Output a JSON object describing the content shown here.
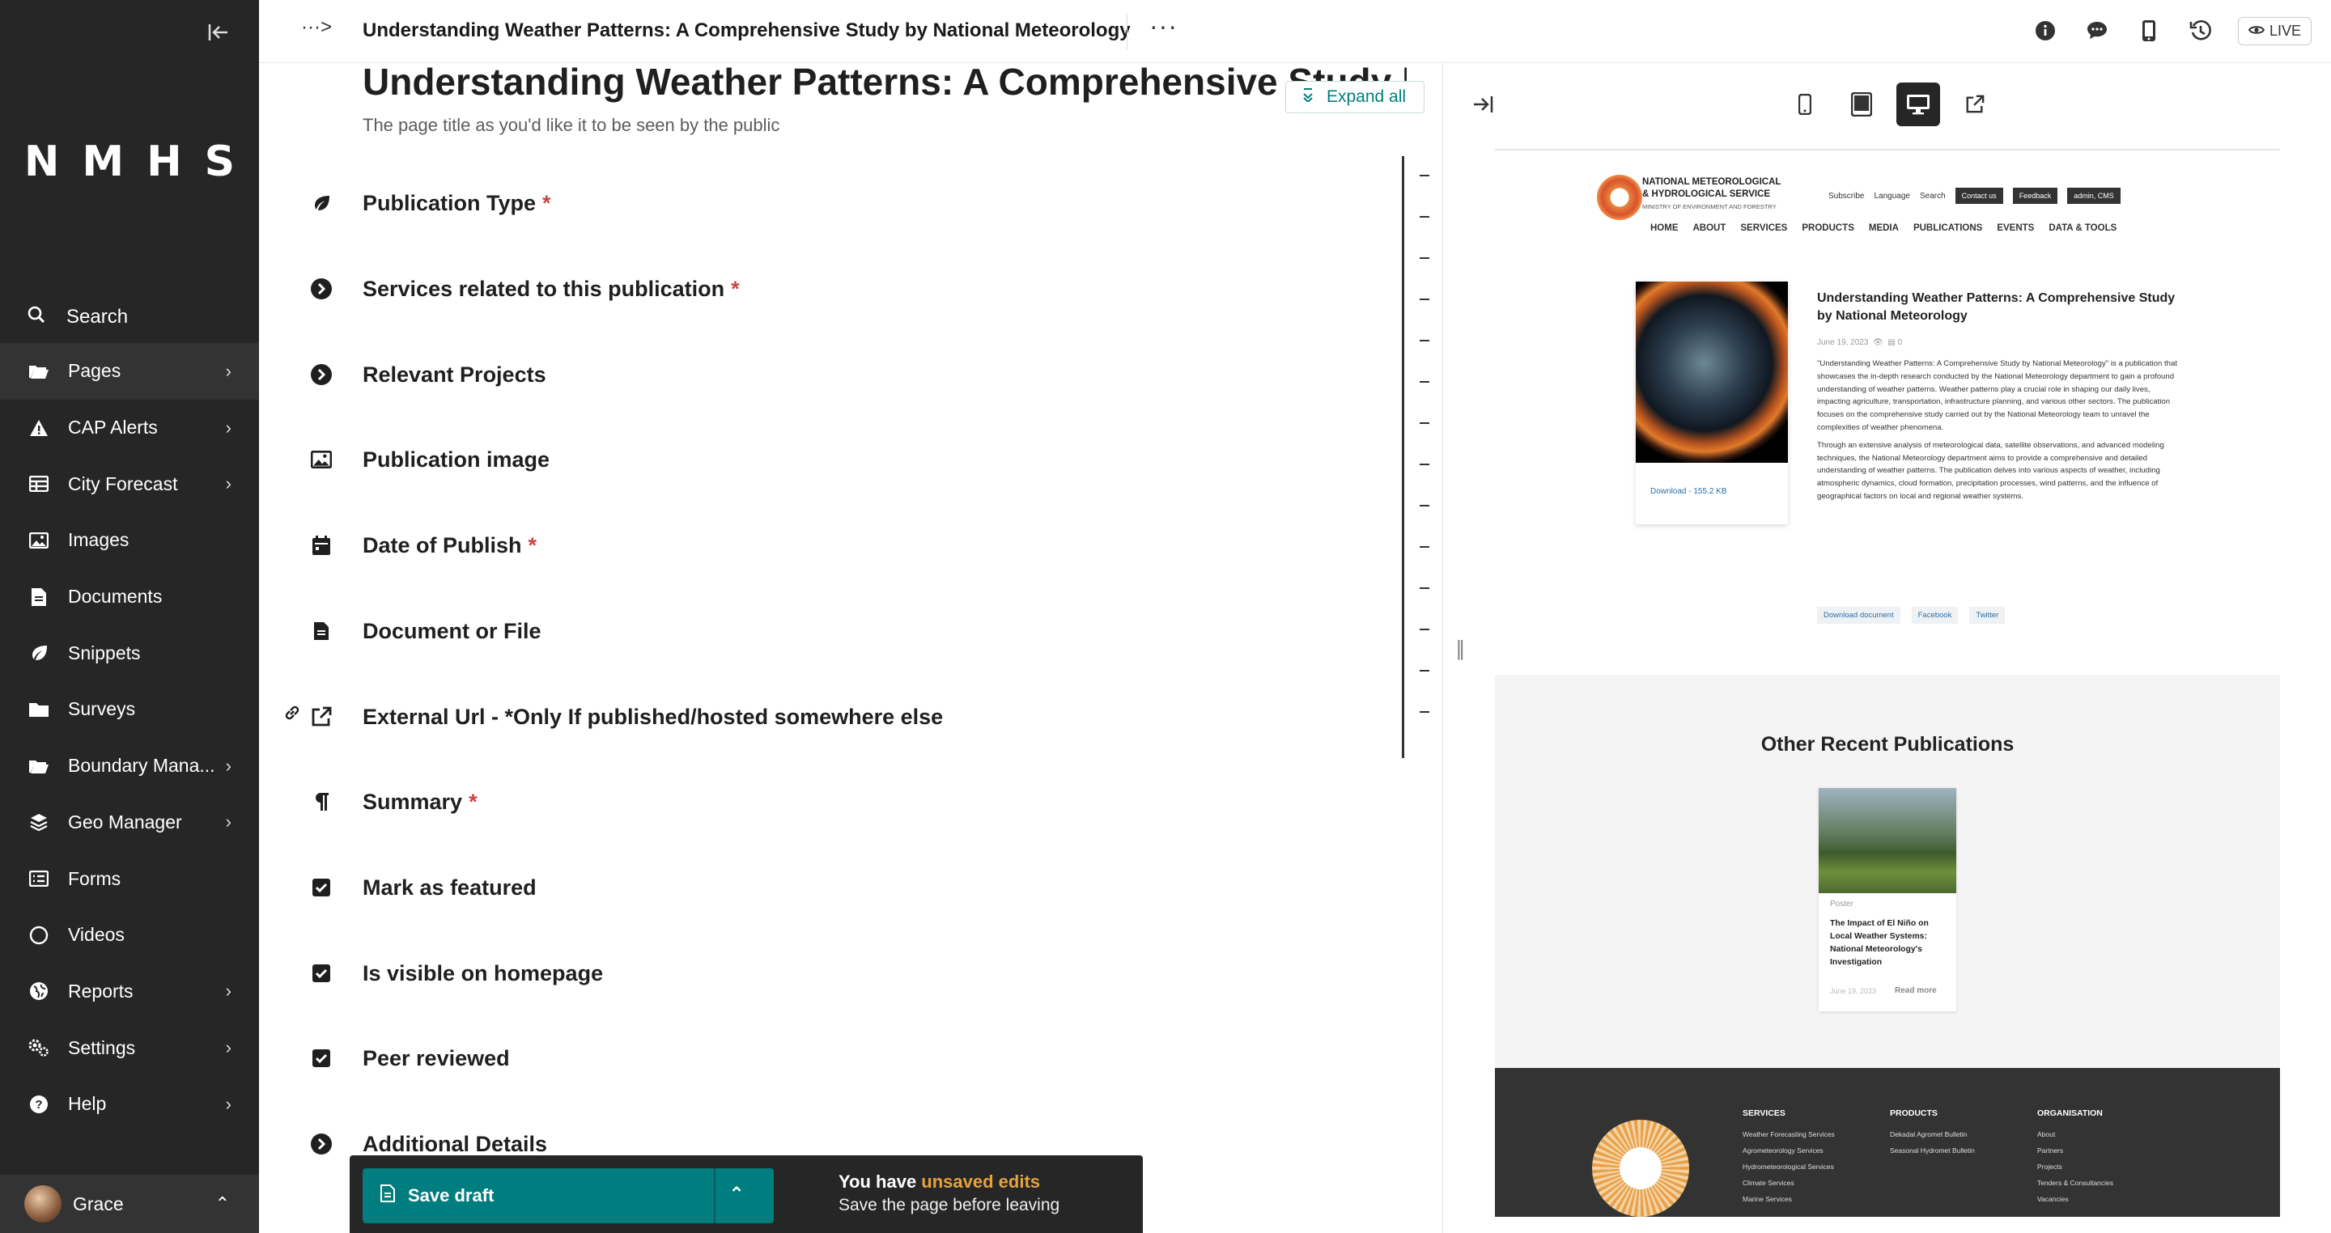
{
  "sidebar": {
    "logo": "NMHS",
    "search_label": "Search",
    "items": [
      {
        "label": "Pages",
        "chevron": true
      },
      {
        "label": "CAP Alerts",
        "chevron": true
      },
      {
        "label": "City Forecast",
        "chevron": true
      },
      {
        "label": "Images",
        "chevron": false
      },
      {
        "label": "Documents",
        "chevron": false
      },
      {
        "label": "Snippets",
        "chevron": false
      },
      {
        "label": "Surveys",
        "chevron": false
      },
      {
        "label": "Boundary Mana...",
        "chevron": true
      },
      {
        "label": "Geo Manager",
        "chevron": true
      },
      {
        "label": "Forms",
        "chevron": false
      },
      {
        "label": "Videos",
        "chevron": false
      },
      {
        "label": "Reports",
        "chevron": true
      },
      {
        "label": "Settings",
        "chevron": true
      },
      {
        "label": "Help",
        "chevron": true
      }
    ],
    "account_name": "Grace"
  },
  "header": {
    "title": "Understanding Weather Patterns: A Comprehensive Study by National Meteorology",
    "live_label": "LIVE"
  },
  "editor": {
    "title_value": "Understanding Weather Patterns: A Comprehensive Study by National Meteorology",
    "title_help": "The page title as you'd like it to be seen by the public",
    "expand_all": "Expand all",
    "fields": [
      {
        "label": "Publication Type",
        "required": true,
        "icon": "leaf-icon"
      },
      {
        "label": "Services related to this publication",
        "required": true,
        "icon": "chevron-circle-icon"
      },
      {
        "label": "Relevant Projects",
        "required": false,
        "icon": "chevron-circle-icon"
      },
      {
        "label": "Publication image",
        "required": false,
        "icon": "image-icon"
      },
      {
        "label": "Date of Publish",
        "required": true,
        "icon": "calendar-icon"
      },
      {
        "label": "Document or File",
        "required": false,
        "icon": "document-icon"
      },
      {
        "label": "External Url - *Only If published/hosted somewhere else",
        "required": false,
        "icon": "external-link-icon"
      },
      {
        "label": "Summary",
        "required": true,
        "icon": "pilcrow-icon"
      },
      {
        "label": "Mark as featured",
        "required": false,
        "icon": "checkbox-icon"
      },
      {
        "label": "Is visible on homepage",
        "required": false,
        "icon": "checkbox-icon"
      },
      {
        "label": "Peer reviewed",
        "required": false,
        "icon": "checkbox-icon"
      },
      {
        "label": "Additional Details",
        "required": false,
        "icon": "chevron-circle-icon"
      }
    ],
    "required_mark": "*"
  },
  "footer": {
    "save_label": "Save draft",
    "unsaved_prefix": "You have ",
    "unsaved_highlight": "unsaved edits",
    "unsaved_sub": "Save the page before leaving"
  },
  "preview": {
    "org_line1": "NATIONAL METEOROLOGICAL",
    "org_line2": "& HYDROLOGICAL SERVICE",
    "org_line3": "MINISTRY OF ENVIRONMENT AND FORESTRY",
    "util": {
      "subscribe": "Subscribe",
      "language": "Language",
      "search": "Search",
      "contact": "Contact us",
      "feedback": "Feedback",
      "admin": "admin, CMS"
    },
    "nav": [
      "HOME",
      "ABOUT",
      "SERVICES",
      "PRODUCTS",
      "MEDIA",
      "PUBLICATIONS",
      "EVENTS",
      "DATA & TOOLS"
    ],
    "pub_title": "Understanding Weather Patterns: A Comprehensive Study by National Meteorology",
    "pub_date": "June 19, 2023",
    "pub_count": "0",
    "download_label": "Download - 155.2 KB",
    "body_p1": "\"Understanding Weather Patterns: A Comprehensive Study by National Meteorology\" is a publication that showcases the in-depth research conducted by the National Meteorology department to gain a profound understanding of weather patterns. Weather patterns play a crucial role in shaping our daily lives, impacting agriculture, transportation, infrastructure planning, and various other sectors. The publication focuses on the comprehensive study carried out by the National Meteorology team to unravel the complexities of weather phenomena.",
    "body_p2": "Through an extensive analysis of meteorological data, satellite observations, and advanced modeling techniques, the National Meteorology department aims to provide a comprehensive and detailed understanding of weather patterns. The publication delves into various aspects of weather, including atmospheric dynamics, cloud formation, precipitation processes, wind patterns, and the influence of geographical factors on local and regional weather systems.",
    "actions": [
      "Download document",
      "Facebook",
      "Twitter"
    ],
    "other_title": "Other Recent Publications",
    "other_card": {
      "category": "Poster",
      "title": "The Impact of El Niño on Local Weather Systems: National Meteorology's Investigation",
      "date": "June 19, 2023",
      "read_more": "Read more"
    },
    "footer_cols": [
      {
        "heading": "SERVICES",
        "links": [
          "Weather Forecasting Services",
          "Agrometeorology Services",
          "Hydrometeorological Services",
          "Climate Services",
          "Marine Services"
        ]
      },
      {
        "heading": "PRODUCTS",
        "links": [
          "Dekadal Agromet Bulletin",
          "Seasonal Hydromet Bulletin"
        ]
      },
      {
        "heading": "ORGANISATION",
        "links": [
          "About",
          "Partners",
          "Projects",
          "Tenders & Consultancies",
          "Vacancies"
        ]
      }
    ]
  },
  "colors": {
    "sidebar": "#262626",
    "accent": "#007d7e",
    "required": "#cd4444",
    "warning": "#e6a23c"
  }
}
